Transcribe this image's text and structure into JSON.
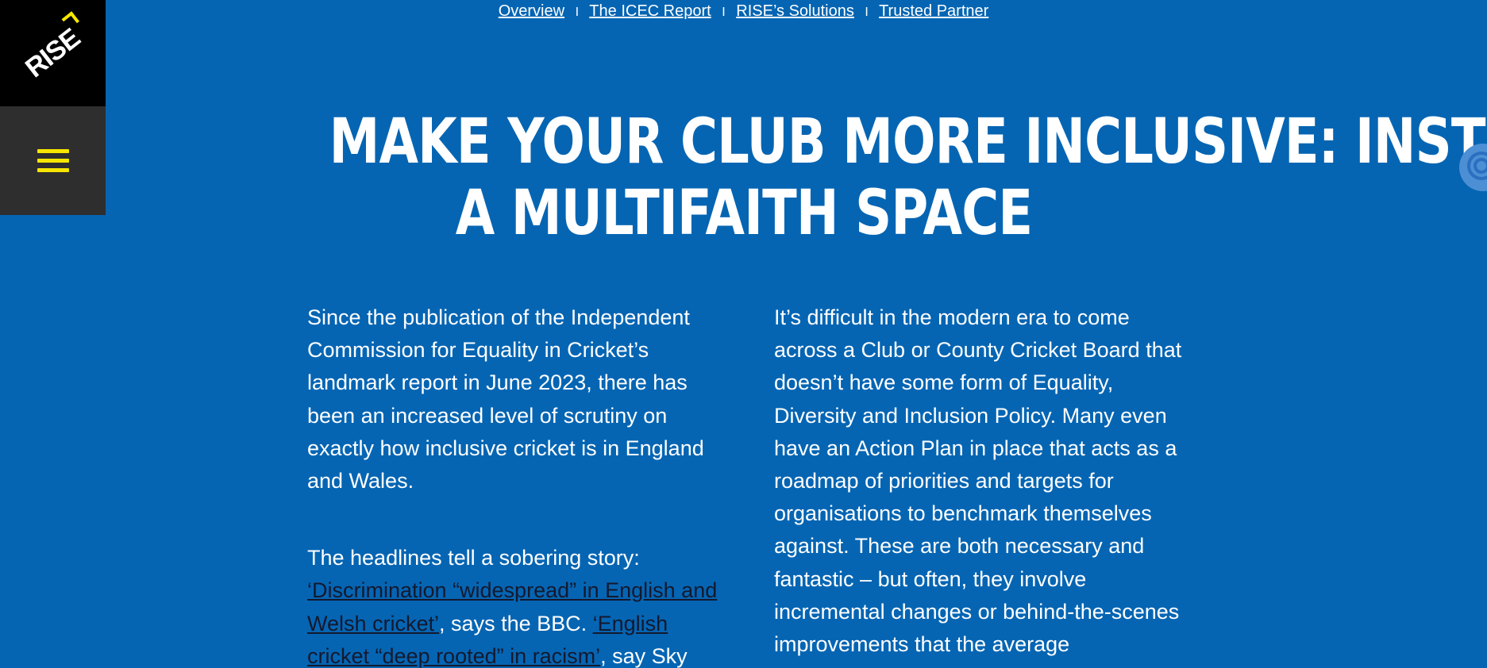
{
  "brand": {
    "logo_text": "RISE",
    "accent_color": "#f7e600",
    "background_color": "#0565b3"
  },
  "menu": {
    "icon": "hamburger-menu-icon"
  },
  "top_nav": {
    "items": [
      {
        "label": "Overview"
      },
      {
        "label": "The ICEC Report"
      },
      {
        "label": "RISE’s Solutions"
      },
      {
        "label": "Trusted Partner"
      }
    ],
    "separator": "I"
  },
  "title": {
    "line1": "MAKE YOUR CLUB MORE INCLUSIVE: INSTALL",
    "line2": "A MULTIFAITH SPACE"
  },
  "left_column": {
    "para1": "Since the publication of the Independent Commission for Equality in Cricket’s landmark report in June 2023, there has been an increased level of scrutiny on exactly how inclusive cricket is in England and Wales.",
    "para2_intro": "The headlines tell a sobering story:",
    "link1": "‘Discrimination “widespread” in English and Welsh cricket’",
    "mid_text": ", says the BBC. ",
    "link2": "‘English cricket “deep rooted” in racism’",
    "tail_text": ", say Sky"
  },
  "right_column": {
    "para1": "It’s difficult in the modern era to come across a Club or County Cricket Board that doesn’t have some form of Equality, Diversity and Inclusion Policy. Many even have an Action Plan in place that acts as a roadmap of priorities and targets for organisations to benchmark themselves against. These are both necessary and fantastic – but often, they involve incremental changes or behind-the-scenes improvements that the average"
  },
  "side_widget": {
    "icon": "concentric-circles-icon"
  }
}
